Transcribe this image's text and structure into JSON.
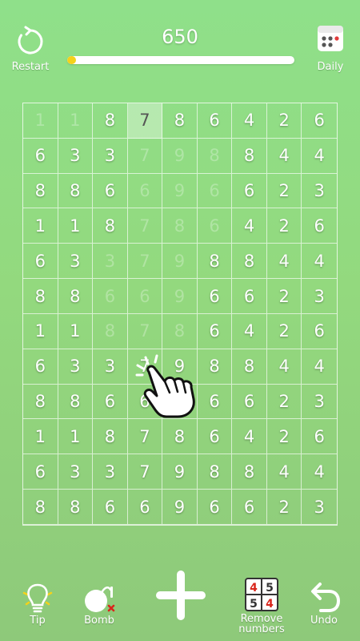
{
  "header": {
    "restart_label": "Restart",
    "score": "650",
    "daily_label": "Daily",
    "progress": 0.04
  },
  "grid": {
    "rows": [
      [
        "1",
        "1",
        "8",
        "7",
        "8",
        "6",
        "4",
        "2",
        "6"
      ],
      [
        "6",
        "3",
        "3",
        "7",
        "9",
        "8",
        "8",
        "4",
        "4"
      ],
      [
        "8",
        "8",
        "6",
        "6",
        "9",
        "6",
        "6",
        "2",
        "3"
      ],
      [
        "1",
        "1",
        "8",
        "7",
        "8",
        "6",
        "4",
        "2",
        "6"
      ],
      [
        "6",
        "3",
        "3",
        "7",
        "9",
        "8",
        "8",
        "4",
        "4"
      ],
      [
        "8",
        "8",
        "6",
        "6",
        "9",
        "6",
        "6",
        "2",
        "3"
      ],
      [
        "1",
        "1",
        "8",
        "7",
        "8",
        "6",
        "4",
        "2",
        "6"
      ],
      [
        "6",
        "3",
        "3",
        "7",
        "9",
        "8",
        "8",
        "4",
        "4"
      ],
      [
        "8",
        "8",
        "6",
        "6",
        "9",
        "6",
        "6",
        "2",
        "3"
      ],
      [
        "1",
        "1",
        "8",
        "7",
        "8",
        "6",
        "4",
        "2",
        "6"
      ],
      [
        "6",
        "3",
        "3",
        "7",
        "9",
        "8",
        "8",
        "4",
        "4"
      ],
      [
        "8",
        "8",
        "6",
        "6",
        "9",
        "6",
        "6",
        "2",
        "3"
      ]
    ],
    "faded": [
      [
        0,
        0
      ],
      [
        0,
        1
      ],
      [
        1,
        3
      ],
      [
        1,
        4
      ],
      [
        1,
        5
      ],
      [
        2,
        3
      ],
      [
        2,
        4
      ],
      [
        2,
        5
      ],
      [
        3,
        3
      ],
      [
        3,
        4
      ],
      [
        3,
        5
      ],
      [
        4,
        2
      ],
      [
        4,
        3
      ],
      [
        4,
        4
      ],
      [
        5,
        2
      ],
      [
        5,
        3
      ],
      [
        5,
        4
      ],
      [
        6,
        2
      ],
      [
        6,
        3
      ],
      [
        6,
        4
      ]
    ],
    "selected": [
      [
        0,
        3
      ]
    ]
  },
  "toolbar": {
    "tip_label": "Tip",
    "bomb_label": "Bomb",
    "remove_label_line1": "Remove",
    "remove_label_line2": "numbers",
    "undo_label": "Undo",
    "remove_icon_digits": [
      "4",
      "5",
      "5",
      "4"
    ]
  },
  "colors": {
    "accent_yellow": "#f4d21a",
    "daily_red": "#e23b3b",
    "remove_red": "#d9261c"
  }
}
